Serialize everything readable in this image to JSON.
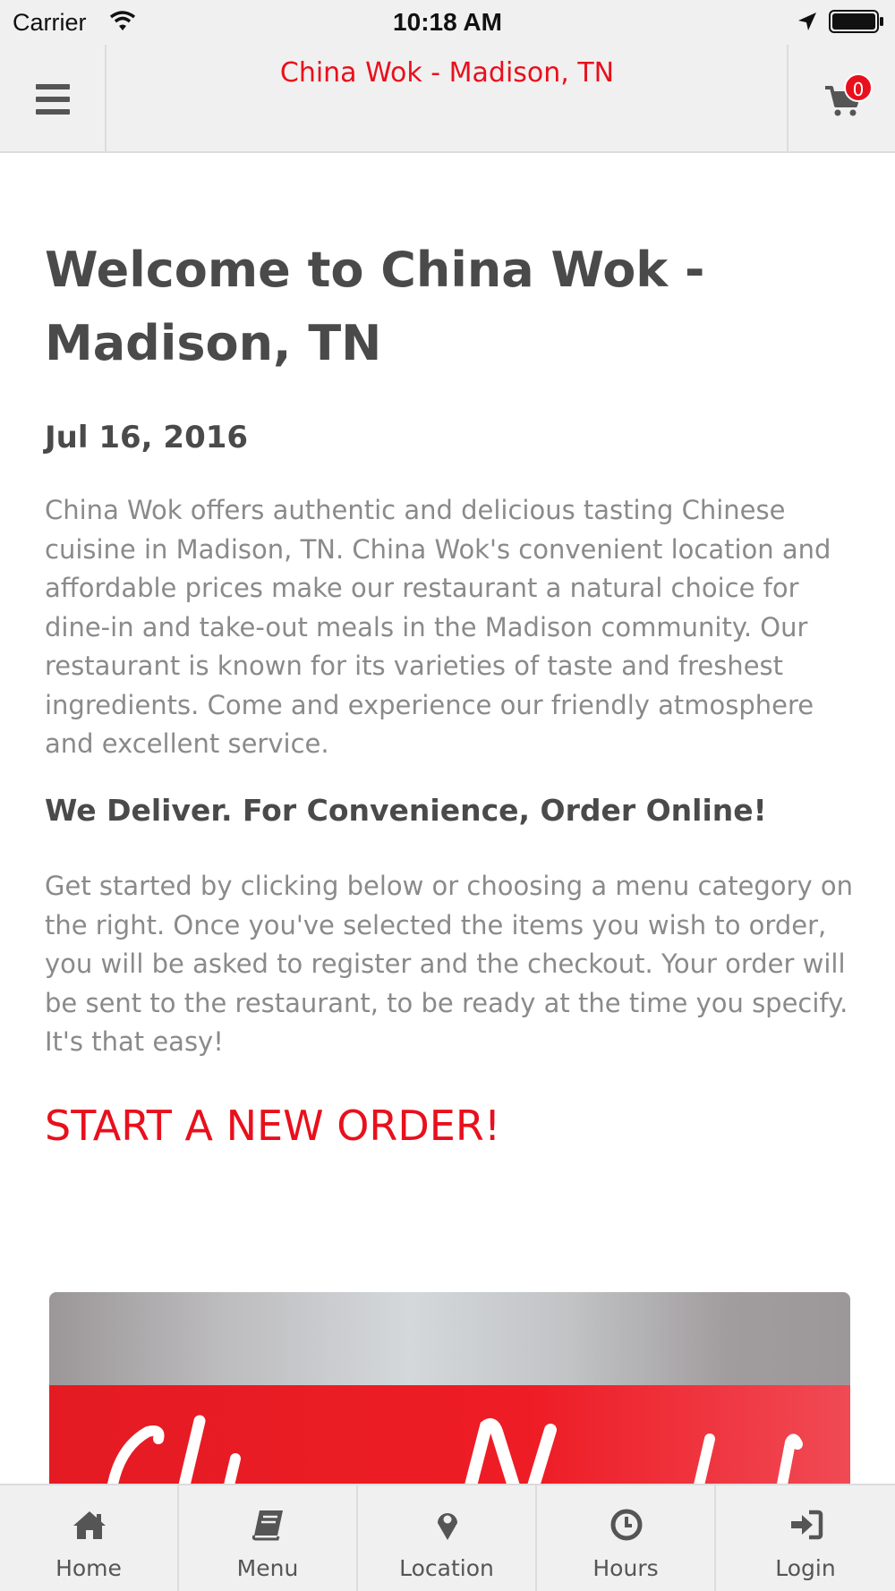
{
  "status_bar": {
    "carrier": "Carrier",
    "time": "10:18 AM"
  },
  "header": {
    "title": "China Wok - Madison, TN",
    "cart_count": "0"
  },
  "content": {
    "title": "Welcome to China Wok - Madison, TN",
    "date": "Jul 16, 2016",
    "intro": "China Wok offers authentic and delicious tasting Chinese cuisine in Madison, TN. China Wok's convenient location and affordable prices make our restaurant a natural choice for dine-in and take-out meals in the Madison community. Our restaurant is known for its varieties of taste and freshest ingredients. Come and experience our friendly atmosphere and excellent service.",
    "section_heading": "We Deliver. For Convenience, Order Online!",
    "instructions": "Get started by clicking below or choosing a menu category on the right. Once you've selected the items you wish to order, you will be asked to register and the checkout. Your order will be sent to the restaurant, to be ready at the time you specify. It's that easy!",
    "cta": "START A NEW ORDER!"
  },
  "tabs": [
    {
      "label": "Home",
      "icon": "home-icon"
    },
    {
      "label": "Menu",
      "icon": "book-icon"
    },
    {
      "label": "Location",
      "icon": "map-pin-icon"
    },
    {
      "label": "Hours",
      "icon": "clock-icon"
    },
    {
      "label": "Login",
      "icon": "sign-in-icon"
    }
  ],
  "colors": {
    "accent": "#e8101c",
    "header_bg": "#f0f0f0",
    "heading_text": "#4a4a4a",
    "body_text": "#8a8a8a"
  }
}
